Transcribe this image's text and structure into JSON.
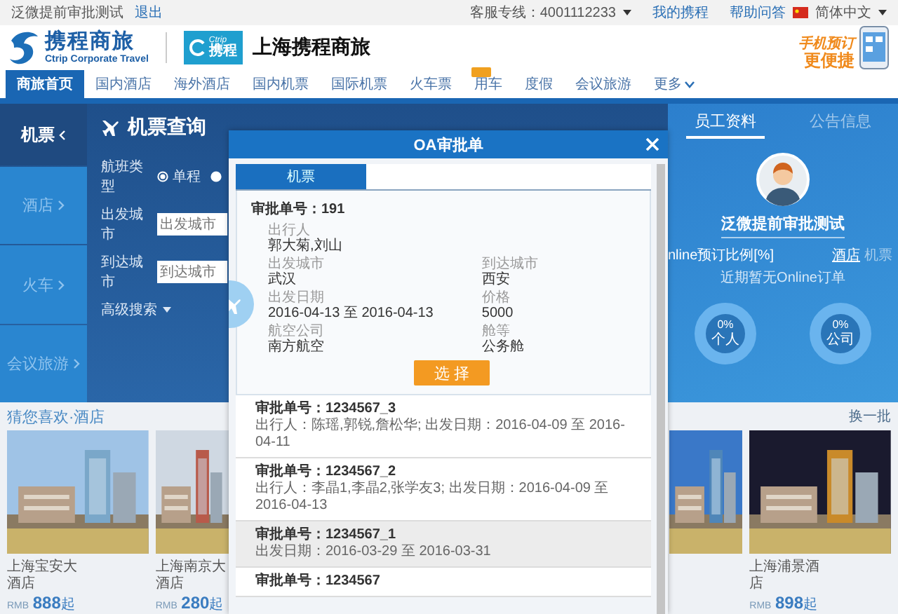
{
  "top_bar": {
    "user": "泛微提前审批测试",
    "logout": "退出",
    "hotline": "客服专线：4001112233",
    "my_trips": "我的携程",
    "help": "帮助问答",
    "language": "简体中文"
  },
  "header": {
    "brand": "携程商旅",
    "brand_en": "Ctrip Corporate Travel",
    "partner_small": "Ctrip",
    "partner_main": "携程",
    "company": "上海携程商旅",
    "promo_small": "手机预订",
    "promo_big": "更便捷"
  },
  "nav": [
    {
      "label": "商旅首页",
      "selected": true,
      "tagged": false
    },
    {
      "label": "国内酒店",
      "selected": false,
      "tagged": false
    },
    {
      "label": "海外酒店",
      "selected": false,
      "tagged": false
    },
    {
      "label": "国内机票",
      "selected": false,
      "tagged": false
    },
    {
      "label": "国际机票",
      "selected": false,
      "tagged": false
    },
    {
      "label": "火车票",
      "selected": false,
      "tagged": false
    },
    {
      "label": "用车",
      "selected": false,
      "tagged": true
    },
    {
      "label": "度假",
      "selected": false,
      "tagged": false
    },
    {
      "label": "会议旅游",
      "selected": false,
      "tagged": false
    },
    {
      "label": "更多",
      "selected": false,
      "tagged": false
    }
  ],
  "search": {
    "side_tabs": [
      {
        "label": "机票",
        "selected": true
      },
      {
        "label": "酒店",
        "selected": false
      },
      {
        "label": "火车",
        "selected": false
      },
      {
        "label": "会议旅游",
        "selected": false
      }
    ],
    "title": "机票查询",
    "trip_type_label": "航班类型",
    "trip_options": [
      {
        "label": "单程",
        "selected": true
      },
      {
        "selected": false
      }
    ],
    "fields": [
      {
        "label": "出发城市",
        "placeholder": "出发城市"
      },
      {
        "label": "到达城市",
        "placeholder": "到达城市"
      }
    ],
    "advanced": "高级搜索"
  },
  "profile": {
    "tabs": [
      {
        "label": "员工资料",
        "selected": true
      },
      {
        "label": "公告信息",
        "selected": false
      }
    ],
    "name": "泛微提前审批测试",
    "ratio_title": "nline预订比例[%]",
    "ratio_tabs": [
      {
        "label": "酒店",
        "selected": true
      },
      {
        "label": "机票",
        "selected": false
      }
    ],
    "note": "近期暂无Online订单",
    "rings": [
      {
        "value": "0%",
        "label": "个人",
        "level": 0
      },
      {
        "value": "0%",
        "label": "公司",
        "level": 0
      }
    ]
  },
  "hotels": {
    "title": "猜您喜欢·酒店",
    "refresh": "换一批",
    "items": [
      {
        "kind": "card",
        "name": "上海宝安大酒店",
        "currency": "RMB",
        "amount": "888",
        "suffix": "起"
      },
      {
        "kind": "card",
        "name": "上海南京大酒店",
        "currency": "RMB",
        "amount": "280",
        "suffix": "起"
      },
      {
        "kind": "picture"
      },
      {
        "kind": "card",
        "name": "上海浦景酒店",
        "currency": "RMB",
        "amount": "898",
        "suffix": "起"
      }
    ]
  },
  "modal": {
    "title": "OA审批单",
    "tabs": [
      {
        "label": "机票",
        "selected": true
      }
    ],
    "order_no": "审批单号：191",
    "fields": [
      {
        "label": "出行人",
        "value": "郭大菊,刘山",
        "wide": true
      },
      {
        "label": "出发城市",
        "value": "武汉",
        "wide": false
      },
      {
        "label": "到达城市",
        "value": "西安",
        "wide": false
      },
      {
        "label": "出发日期",
        "value": "2016-04-13 至 2016-04-13",
        "wide": false
      },
      {
        "label": "价格",
        "value": "5000",
        "wide": false
      },
      {
        "label": "航空公司",
        "value": "南方航空",
        "wide": false
      },
      {
        "label": "舱等",
        "value": "公务舱",
        "wide": false
      }
    ],
    "select_button": "选 择",
    "records": [
      {
        "order_no": "审批单号：1234567_3",
        "detail": "出行人：陈瑶,郭锐,詹松华; 出发日期：2016-04-09 至 2016-04-11",
        "selected": false
      },
      {
        "order_no": "审批单号：1234567_2",
        "detail": "出行人：李晶1,李晶2,张学友3; 出发日期：2016-04-09 至 2016-04-13",
        "selected": false
      },
      {
        "order_no": "审批单号：1234567_1",
        "detail": "出发日期：2016-03-29 至 2016-03-31",
        "selected": true
      },
      {
        "order_no": "审批单号：1234567",
        "selected": false
      }
    ]
  }
}
